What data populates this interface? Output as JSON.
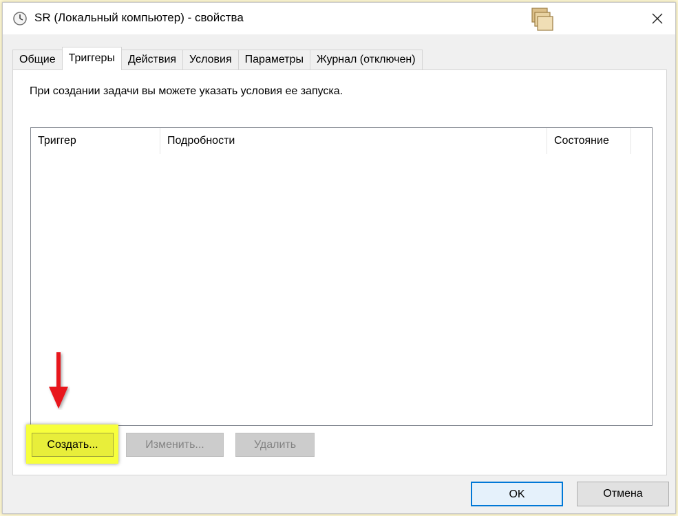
{
  "window": {
    "title": "SR (Локальный компьютер) - свойства",
    "icons": {
      "title": "clock-icon",
      "stack": "stack-icon",
      "close": "close-icon"
    }
  },
  "tabs": [
    {
      "label": "Общие"
    },
    {
      "label": "Триггеры",
      "active": true
    },
    {
      "label": "Действия"
    },
    {
      "label": "Условия"
    },
    {
      "label": "Параметры"
    },
    {
      "label": "Журнал (отключен)"
    }
  ],
  "panel": {
    "intro": "При создании задачи вы можете указать условия ее запуска.",
    "table": {
      "columns": [
        "Триггер",
        "Подробности",
        "Состояние"
      ],
      "rows": []
    },
    "buttons": {
      "create": "Создать...",
      "edit": "Изменить...",
      "delete": "Удалить"
    }
  },
  "footer": {
    "ok": "OK",
    "cancel": "Отмена"
  },
  "colors": {
    "highlight": "#f7ff3c",
    "arrow": "#e8141b",
    "ok_border": "#0078d7"
  }
}
